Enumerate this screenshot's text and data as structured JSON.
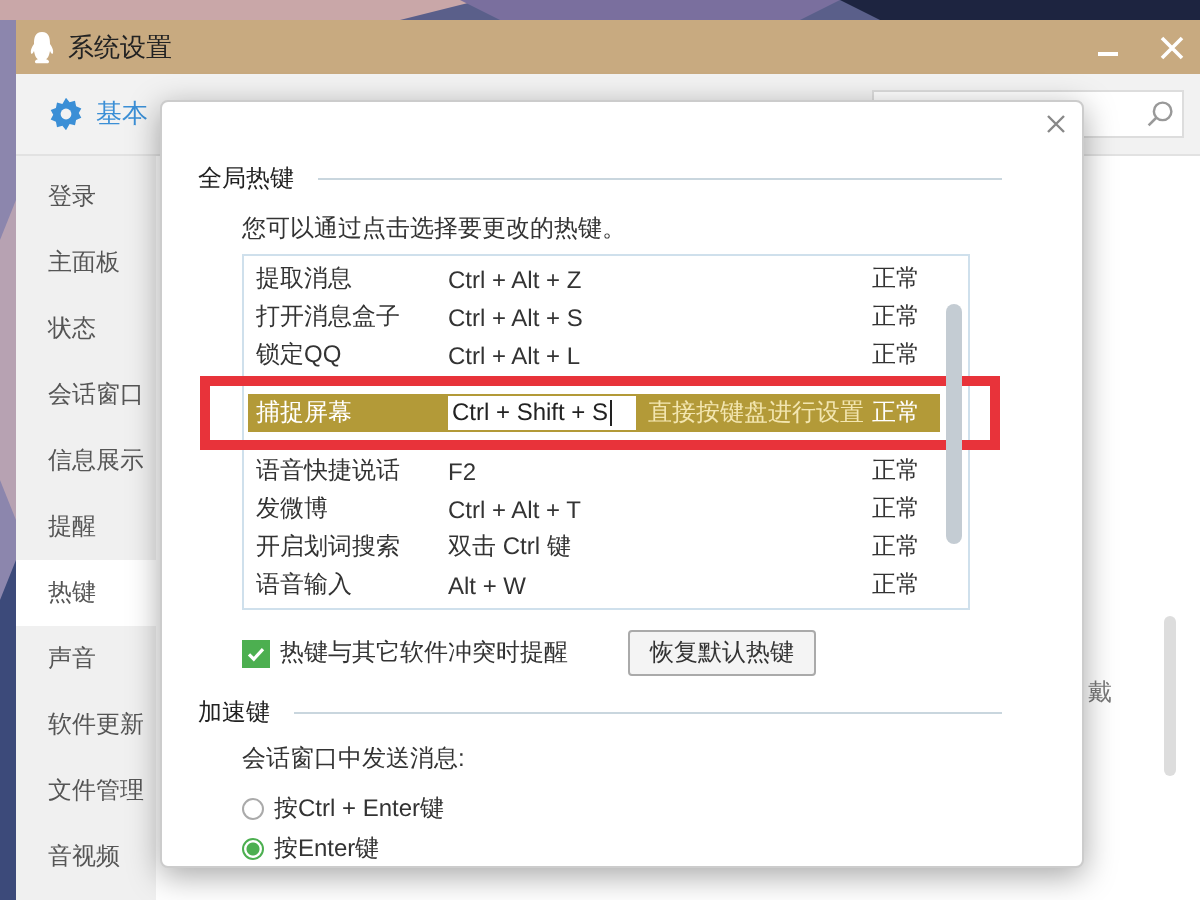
{
  "window": {
    "title": "系统设置"
  },
  "toolbar": {
    "tab": "基本"
  },
  "sidebar": {
    "items": [
      {
        "label": "登录",
        "selected": false
      },
      {
        "label": "主面板",
        "selected": false
      },
      {
        "label": "状态",
        "selected": false
      },
      {
        "label": "会话窗口",
        "selected": false
      },
      {
        "label": "信息展示",
        "selected": false
      },
      {
        "label": "提醒",
        "selected": false
      },
      {
        "label": "热键",
        "selected": true
      },
      {
        "label": "声音",
        "selected": false
      },
      {
        "label": "软件更新",
        "selected": false
      },
      {
        "label": "文件管理",
        "selected": false
      },
      {
        "label": "音视频",
        "selected": false
      }
    ]
  },
  "background_text": "戴",
  "dialog": {
    "hotkeys": {
      "title": "全局热键",
      "hint": "您可以通过点击选择要更改的热键。",
      "rows": [
        {
          "name": "提取消息",
          "keys": "Ctrl + Alt + Z",
          "status": "正常",
          "selected": false
        },
        {
          "name": "打开消息盒子",
          "keys": "Ctrl + Alt + S",
          "status": "正常",
          "selected": false
        },
        {
          "name": "锁定QQ",
          "keys": "Ctrl + Alt + L",
          "status": "正常",
          "selected": false
        },
        {
          "name": "捕捉屏幕",
          "keys": "Ctrl + Shift + S",
          "prompt": "直接按键盘进行设置",
          "status": "正常",
          "selected": true
        },
        {
          "name": "语音快捷说话",
          "keys": "F2",
          "status": "正常",
          "selected": false
        },
        {
          "name": "发微博",
          "keys": "Ctrl + Alt + T",
          "status": "正常",
          "selected": false
        },
        {
          "name": "开启划词搜索",
          "keys": "双击 Ctrl 键",
          "status": "正常",
          "selected": false
        },
        {
          "name": "语音输入",
          "keys": "Alt + W",
          "status": "正常",
          "selected": false
        }
      ],
      "conflict_alert": {
        "label": "热键与其它软件冲突时提醒",
        "checked": true
      },
      "restore_button": "恢复默认热键"
    },
    "accelerators": {
      "title": "加速键",
      "label": "会话窗口中发送消息:",
      "options": [
        {
          "label": "按Ctrl + Enter键",
          "selected": false
        },
        {
          "label": "按Enter键",
          "selected": true
        }
      ]
    }
  }
}
